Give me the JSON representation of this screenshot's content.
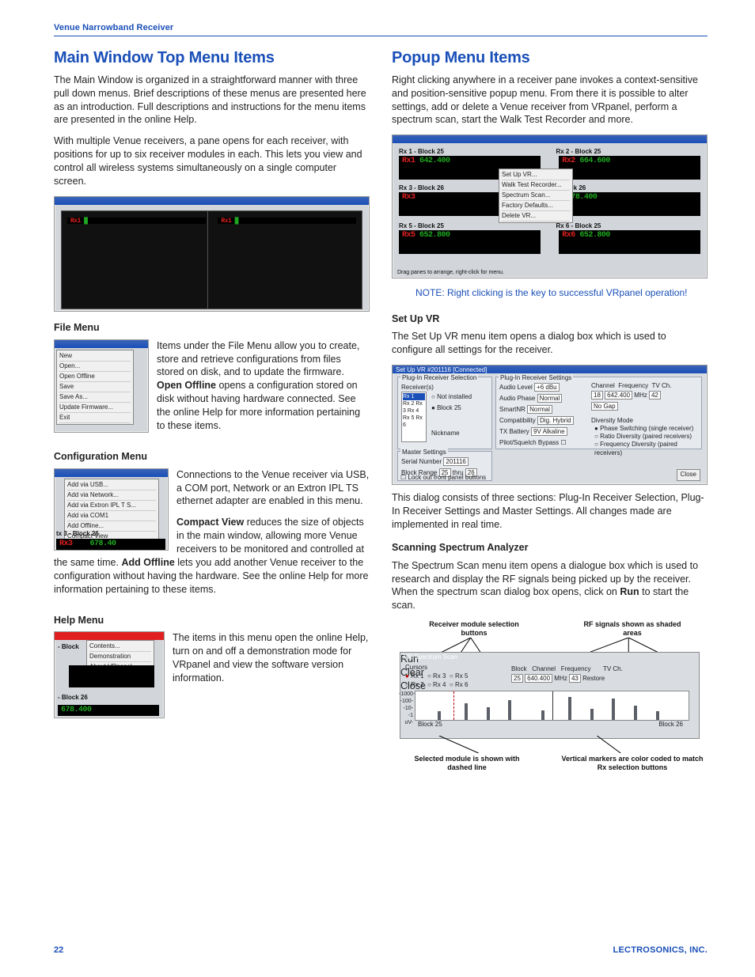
{
  "runhead": "Venue Narrowband Receiver",
  "left": {
    "h1": "Main Window Top Menu Items",
    "p1": "The Main Window is organized in a straightforward manner with three pull down menus. Brief descriptions of these menus are presented here as an introduction. Full descriptions and instructions for the menu items are presented in the online Help.",
    "p2": "With multiple Venue receivers, a pane opens for each receiver, with positions for up to six receiver modules in each. This lets you view and control all wireless systems simultaneously on a single computer screen.",
    "file_h": "File Menu",
    "file_p": "Items under the File Menu allow you to create, store and retrieve configurations from files stored on disk, and to update the firmware. Open Offline opens a configuration stored on disk without having hardware connected. See the online Help for more information pertaining to these items.",
    "file_menu": [
      "New",
      "Open...",
      "Open Offline",
      "Save",
      "Save As...",
      "Update Firmware...",
      "Exit"
    ],
    "conf_h": "Configuration Menu",
    "conf_p1": "Connections to the Venue receiver via USB, a COM port, Network or an Extron IPL TS ethernet adapter are enabled in this menu.",
    "conf_p2": "Compact View reduces the size of objects in the main window, allowing more Venue receivers to be monitored and controlled at the same time. Add Offline lets you add another Venue receiver to the configuration without having the hardware. See the online Help for more information pertaining to these items.",
    "conf_menu": [
      "Add via USB...",
      "Add via Network...",
      "Add via Extron IPL T S...",
      "Add via COM1",
      "Add Offline...",
      "Compact View"
    ],
    "help_h": "Help Menu",
    "help_p": "The items in this menu open the online Help, turn on and off a demonstration mode for VRpanel and view the software version information.",
    "help_menu": [
      "Contents...",
      "Demonstration",
      "About VRpanel..."
    ],
    "conf_block_label": "tx 3 - Block 26",
    "conf_lcd": "678.40",
    "help_block_label_upper": "- Block",
    "help_block_label_lower": "- Block 26",
    "help_lcd": "678.400"
  },
  "right": {
    "h1": "Popup Menu Items",
    "p1": "Right clicking anywhere in a receiver pane invokes a context-sensitive and position-sensitive popup menu. From there it is possible to alter settings, add or delete a Venue receiver from VRpanel, perform a spectrum scan, start the Walk Test Recorder and more.",
    "note": "NOTE:  Right clicking is the key to successful VRpanel operation!",
    "popup_blocks": [
      "Rx 1 - Block 25",
      "Rx 2 - Block 25",
      "Rx 3 - Block 26",
      "- Block 26",
      "Rx 5 - Block 25",
      "Rx 6 - Block 25"
    ],
    "popup_drag": "Drag panes to arrange, right-click for menu.",
    "popup_ctx": [
      "Set Up VR...",
      "Walk Test Recorder...",
      "",
      "Spectrum Scan...",
      "",
      "Factory Defaults...",
      "Delete VR..."
    ],
    "setup_h": "Set Up VR",
    "setup_p1": "The Set Up VR menu item opens a dialog box which is used to configure all settings for the receiver.",
    "setup_p2": "This dialog consists of three sections: Plug-In Receiver Selection, Plug-In Receiver Settings and Master Settings. All changes made are implemented in real time.",
    "setup_title": "Set Up VR #201116 [Connected]",
    "setup_sec1": "Plug-In Receiver Selection",
    "setup_sec2": "Plug-In Receiver Settings",
    "setup_sec3": "Master Settings",
    "setup_labels": {
      "received": "Receiver(s)",
      "rxlist": [
        "Rx 1",
        "Rx 2",
        "Rx 3",
        "Rx 4",
        "Rx 5",
        "Rx 6"
      ],
      "not_installed": "Not installed",
      "block": "Block 25",
      "nickname": "Nickname",
      "audio_level": "Audio Level",
      "audio_level_val": "+6 dBu",
      "audio_phase": "Audio Phase",
      "audio_phase_val": "Normal",
      "smart_nr": "SmartNR",
      "smart_nr_val": "Normal",
      "compat": "Compatibility",
      "compat_val": "Dig. Hybrid",
      "tx_batt": "TX Battery",
      "tx_batt_val": "9V Alkaline",
      "pilot": "Pilot/Squelch Bypass",
      "channel": "Channel",
      "frequency": "Frequency",
      "freq_val": "642.400",
      "mhz": "MHz",
      "tvch": "TV Ch.",
      "tvch_val": "42",
      "nogap": "No Gap",
      "divmode": "Diversity Mode",
      "div1": "Phase Switching (single receiver)",
      "div2": "Ratio Diversity (paired receivers)",
      "div3": "Frequency Diversity (paired receivers)",
      "serial": "Serial Number",
      "serial_val": "201116",
      "block_range": "Block Range",
      "block_from": "25",
      "block_to": "26",
      "thru": "thru",
      "lockout": "Lock out front panel buttons",
      "close": "Close"
    },
    "scan_h": "Scanning Spectrum Analyzer",
    "scan_p": "The Spectrum Scan menu item opens a dialogue box which is used to research and display the RF signals being picked up by the receiver.  When the spectrum scan dialog box opens, click on Run to start the scan.",
    "spec_title": "VR Spectrum Scan",
    "spec_cursors": "Cursors",
    "spec_block": "Block",
    "spec_chan": "Channel",
    "spec_freq": "Frequency",
    "spec_freq_val": "640.400",
    "spec_mhz": "MHz",
    "spec_tvch": "TV Ch.",
    "spec_tvch_val": "43",
    "spec_run": "Run",
    "spec_clear": "Clear",
    "spec_close": "Close",
    "spec_restore": "Restore",
    "spec_rx": [
      "Rx 1",
      "Rx 2",
      "Rx 3",
      "Rx 4",
      "Rx 5",
      "Rx 6"
    ],
    "spec_block25": "Block 25",
    "spec_block26": "Block 26",
    "spec_scale": [
      "-1000-",
      "-100-",
      "-10-",
      "-1 uV-"
    ],
    "ann1": "Receiver module selection buttons",
    "ann2": "RF signals shown as shaded areas",
    "ann3": "Selected module is shown with dashed line",
    "ann4": "Vertical markers are color coded to match Rx selection buttons"
  },
  "footer_page": "22",
  "footer_brand": "LECTROSONICS, INC."
}
